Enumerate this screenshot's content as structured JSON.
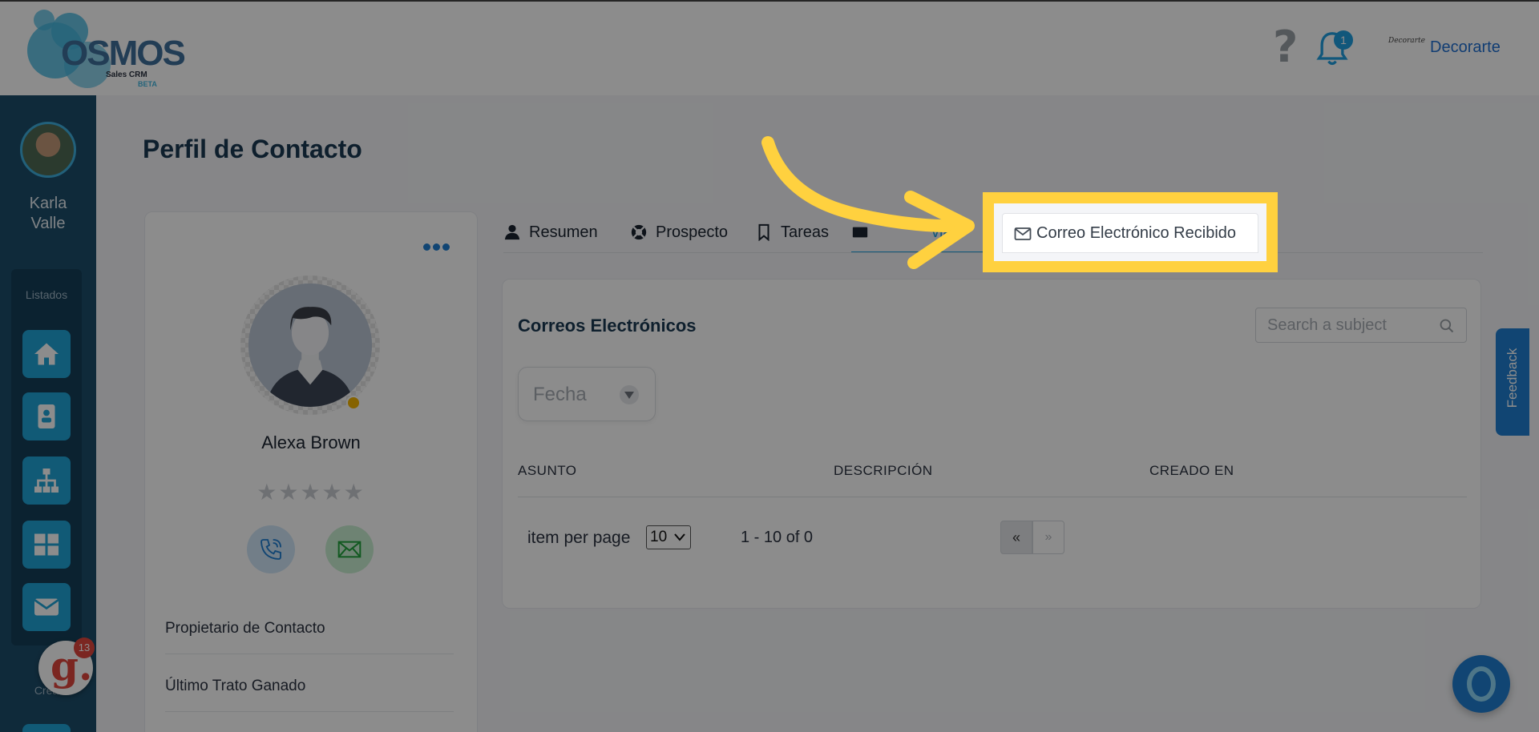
{
  "app": {
    "logo_text": "OSMOS",
    "logo_subtitle": "Sales CRM",
    "logo_badge": "BETA",
    "notification_count": "1",
    "company_logo_text": "Decorarte",
    "company_name": "Decorarte"
  },
  "sidebar": {
    "user_name": "Karla\nValle",
    "section_title": "Listados",
    "items": [
      {
        "icon": "home-icon"
      },
      {
        "icon": "contact-card-icon"
      },
      {
        "icon": "org-chart-icon"
      },
      {
        "icon": "dashboard-grid-icon"
      },
      {
        "icon": "mail-icon"
      }
    ],
    "create_label": "Crea",
    "widget_letter": "g.",
    "widget_badge": "13"
  },
  "page": {
    "title": "Perfil de Contacto"
  },
  "profile": {
    "contact_name": "Alexa Brown",
    "rating_stars": "★★★★★",
    "rating_value": 0,
    "status_color": "#f4b400",
    "fields": [
      {
        "label": "Propietario de Contacto"
      },
      {
        "label": "Último Trato Ganado"
      }
    ]
  },
  "tabs": [
    {
      "label": "Resumen",
      "icon": "user-icon"
    },
    {
      "label": "Prospecto",
      "icon": "lifebuoy-icon"
    },
    {
      "label": "Tareas",
      "icon": "bookmark-icon"
    },
    {
      "label": "viad",
      "icon": "envelope-icon"
    },
    {
      "label": "Correo Electrónico Recibido",
      "icon": "envelope-outline-icon"
    }
  ],
  "emails": {
    "title": "Correos Electrónicos",
    "search_placeholder": "Search a subject",
    "date_filter_label": "Fecha",
    "columns": [
      "ASUNTO",
      "DESCRIPCIÓN",
      "CREADO EN"
    ],
    "rows": [],
    "items_per_page_label": "item per page",
    "items_per_page_value": "10",
    "range_text": "1 - 10 of 0",
    "prev_label": "«",
    "next_label": "»"
  },
  "feedback_label": "Feedback",
  "colors": {
    "accent": "#1f9fe0",
    "sidebar": "#1d4d6a",
    "highlight": "#ffd13f"
  }
}
